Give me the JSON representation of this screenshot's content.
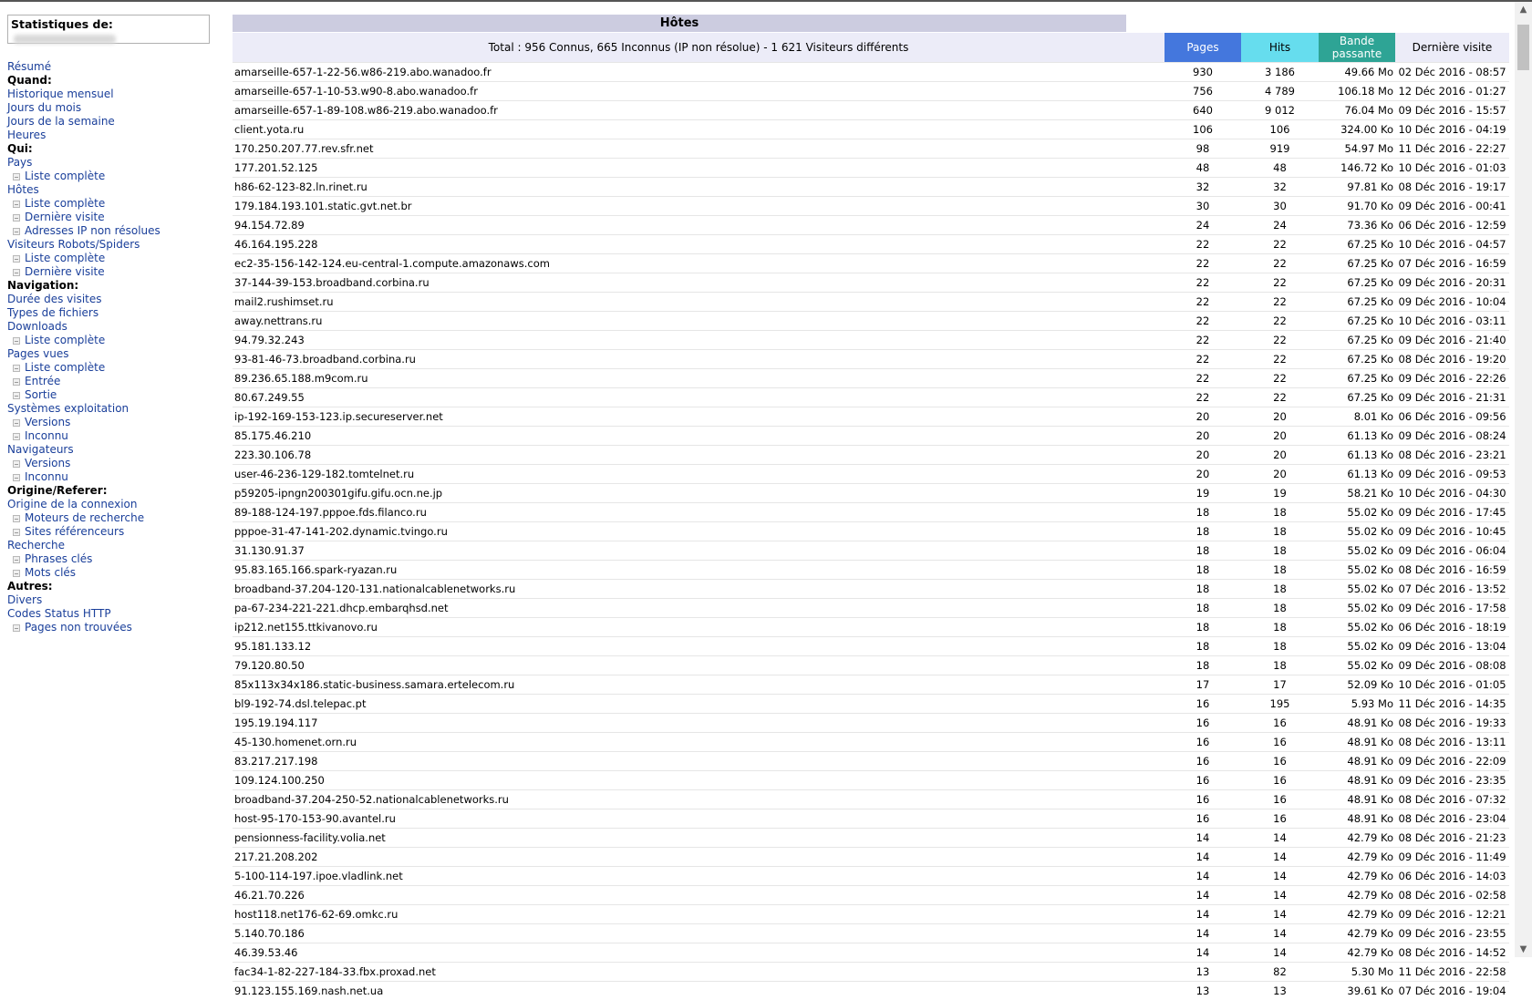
{
  "sidebar": {
    "title": "Statistiques de:",
    "menu": [
      {
        "t": "lnk",
        "label": "Résumé"
      },
      {
        "t": "sec",
        "label": "Quand:"
      },
      {
        "t": "lnk",
        "label": "Historique mensuel"
      },
      {
        "t": "lnk",
        "label": "Jours du mois"
      },
      {
        "t": "lnk",
        "label": "Jours de la semaine"
      },
      {
        "t": "lnk",
        "label": "Heures"
      },
      {
        "t": "sec",
        "label": "Qui:"
      },
      {
        "t": "lnk",
        "label": "Pays"
      },
      {
        "t": "sub",
        "label": "Liste complète"
      },
      {
        "t": "lnk",
        "label": "Hôtes"
      },
      {
        "t": "sub",
        "label": "Liste complète"
      },
      {
        "t": "sub",
        "label": "Dernière visite"
      },
      {
        "t": "sub",
        "label": "Adresses IP non résolues"
      },
      {
        "t": "lnk",
        "label": "Visiteurs Robots/Spiders"
      },
      {
        "t": "sub",
        "label": "Liste complète"
      },
      {
        "t": "sub",
        "label": "Dernière visite"
      },
      {
        "t": "sec",
        "label": "Navigation:"
      },
      {
        "t": "lnk",
        "label": "Durée des visites"
      },
      {
        "t": "lnk",
        "label": "Types de fichiers"
      },
      {
        "t": "lnk",
        "label": "Downloads"
      },
      {
        "t": "sub",
        "label": "Liste complète"
      },
      {
        "t": "lnk",
        "label": "Pages vues"
      },
      {
        "t": "sub",
        "label": "Liste complète"
      },
      {
        "t": "sub",
        "label": "Entrée"
      },
      {
        "t": "sub",
        "label": "Sortie"
      },
      {
        "t": "lnk",
        "label": "Systèmes exploitation"
      },
      {
        "t": "sub",
        "label": "Versions"
      },
      {
        "t": "sub",
        "label": "Inconnu"
      },
      {
        "t": "lnk",
        "label": "Navigateurs"
      },
      {
        "t": "sub",
        "label": "Versions"
      },
      {
        "t": "sub",
        "label": "Inconnu"
      },
      {
        "t": "sec",
        "label": "Origine/Referer:"
      },
      {
        "t": "lnk",
        "label": "Origine de la connexion"
      },
      {
        "t": "sub",
        "label": "Moteurs de recherche"
      },
      {
        "t": "sub",
        "label": "Sites référenceurs"
      },
      {
        "t": "lnk",
        "label": "Recherche"
      },
      {
        "t": "sub",
        "label": "Phrases clés"
      },
      {
        "t": "sub",
        "label": "Mots clés"
      },
      {
        "t": "sec",
        "label": "Autres:"
      },
      {
        "t": "lnk",
        "label": "Divers"
      },
      {
        "t": "lnk",
        "label": "Codes Status HTTP"
      },
      {
        "t": "sub",
        "label": "Pages non trouvées"
      }
    ]
  },
  "main": {
    "title": "Hôtes",
    "total": "Total : 956 Connus, 665 Inconnus (IP non résolue) - 1 621 Visiteurs différents",
    "headers": {
      "pages": "Pages",
      "hits": "Hits",
      "bw_line1": "Bande",
      "bw_line2": "passante",
      "last": "Dernière visite"
    },
    "colors": {
      "pages": "#4477dd",
      "hits": "#66ddee",
      "bandwidth": "#2ea495",
      "title_bg": "#cccce0"
    },
    "rows": [
      [
        "amarseille-657-1-22-56.w86-219.abo.wanadoo.fr",
        "930",
        "3 186",
        "49.66 Mo",
        "02 Déc 2016 - 08:57"
      ],
      [
        "amarseille-657-1-10-53.w90-8.abo.wanadoo.fr",
        "756",
        "4 789",
        "106.18 Mo",
        "12 Déc 2016 - 01:27"
      ],
      [
        "amarseille-657-1-89-108.w86-219.abo.wanadoo.fr",
        "640",
        "9 012",
        "76.04 Mo",
        "09 Déc 2016 - 15:57"
      ],
      [
        "client.yota.ru",
        "106",
        "106",
        "324.00 Ko",
        "10 Déc 2016 - 04:19"
      ],
      [
        "170.250.207.77.rev.sfr.net",
        "98",
        "919",
        "54.97 Mo",
        "11 Déc 2016 - 22:27"
      ],
      [
        "177.201.52.125",
        "48",
        "48",
        "146.72 Ko",
        "10 Déc 2016 - 01:03"
      ],
      [
        "h86-62-123-82.ln.rinet.ru",
        "32",
        "32",
        "97.81 Ko",
        "08 Déc 2016 - 19:17"
      ],
      [
        "179.184.193.101.static.gvt.net.br",
        "30",
        "30",
        "91.70 Ko",
        "09 Déc 2016 - 00:41"
      ],
      [
        "94.154.72.89",
        "24",
        "24",
        "73.36 Ko",
        "06 Déc 2016 - 12:59"
      ],
      [
        "46.164.195.228",
        "22",
        "22",
        "67.25 Ko",
        "10 Déc 2016 - 04:57"
      ],
      [
        "ec2-35-156-142-124.eu-central-1.compute.amazonaws.com",
        "22",
        "22",
        "67.25 Ko",
        "07 Déc 2016 - 16:59"
      ],
      [
        "37-144-39-153.broadband.corbina.ru",
        "22",
        "22",
        "67.25 Ko",
        "09 Déc 2016 - 20:31"
      ],
      [
        "mail2.rushimset.ru",
        "22",
        "22",
        "67.25 Ko",
        "09 Déc 2016 - 10:04"
      ],
      [
        "away.nettrans.ru",
        "22",
        "22",
        "67.25 Ko",
        "10 Déc 2016 - 03:11"
      ],
      [
        "94.79.32.243",
        "22",
        "22",
        "67.25 Ko",
        "09 Déc 2016 - 21:40"
      ],
      [
        "93-81-46-73.broadband.corbina.ru",
        "22",
        "22",
        "67.25 Ko",
        "08 Déc 2016 - 19:20"
      ],
      [
        "89.236.65.188.m9com.ru",
        "22",
        "22",
        "67.25 Ko",
        "09 Déc 2016 - 22:26"
      ],
      [
        "80.67.249.55",
        "22",
        "22",
        "67.25 Ko",
        "09 Déc 2016 - 21:31"
      ],
      [
        "ip-192-169-153-123.ip.secureserver.net",
        "20",
        "20",
        "8.01 Ko",
        "06 Déc 2016 - 09:56"
      ],
      [
        "85.175.46.210",
        "20",
        "20",
        "61.13 Ko",
        "09 Déc 2016 - 08:24"
      ],
      [
        "223.30.106.78",
        "20",
        "20",
        "61.13 Ko",
        "08 Déc 2016 - 23:21"
      ],
      [
        "user-46-236-129-182.tomtelnet.ru",
        "20",
        "20",
        "61.13 Ko",
        "09 Déc 2016 - 09:53"
      ],
      [
        "p59205-ipngn200301gifu.gifu.ocn.ne.jp",
        "19",
        "19",
        "58.21 Ko",
        "10 Déc 2016 - 04:30"
      ],
      [
        "89-188-124-197.pppoe.fds.filanco.ru",
        "18",
        "18",
        "55.02 Ko",
        "09 Déc 2016 - 17:45"
      ],
      [
        "pppoe-31-47-141-202.dynamic.tvingo.ru",
        "18",
        "18",
        "55.02 Ko",
        "09 Déc 2016 - 10:45"
      ],
      [
        "31.130.91.37",
        "18",
        "18",
        "55.02 Ko",
        "09 Déc 2016 - 06:04"
      ],
      [
        "95.83.165.166.spark-ryazan.ru",
        "18",
        "18",
        "55.02 Ko",
        "08 Déc 2016 - 16:59"
      ],
      [
        "broadband-37.204-120-131.nationalcablenetworks.ru",
        "18",
        "18",
        "55.02 Ko",
        "07 Déc 2016 - 13:52"
      ],
      [
        "pa-67-234-221-221.dhcp.embarqhsd.net",
        "18",
        "18",
        "55.02 Ko",
        "09 Déc 2016 - 17:58"
      ],
      [
        "ip212.net155.ttkivanovo.ru",
        "18",
        "18",
        "55.02 Ko",
        "06 Déc 2016 - 18:19"
      ],
      [
        "95.181.133.12",
        "18",
        "18",
        "55.02 Ko",
        "09 Déc 2016 - 13:04"
      ],
      [
        "79.120.80.50",
        "18",
        "18",
        "55.02 Ko",
        "09 Déc 2016 - 08:08"
      ],
      [
        "85x113x34x186.static-business.samara.ertelecom.ru",
        "17",
        "17",
        "52.09 Ko",
        "10 Déc 2016 - 01:05"
      ],
      [
        "bl9-192-74.dsl.telepac.pt",
        "16",
        "195",
        "5.93 Mo",
        "11 Déc 2016 - 14:35"
      ],
      [
        "195.19.194.117",
        "16",
        "16",
        "48.91 Ko",
        "08 Déc 2016 - 19:33"
      ],
      [
        "45-130.homenet.orn.ru",
        "16",
        "16",
        "48.91 Ko",
        "08 Déc 2016 - 13:11"
      ],
      [
        "83.217.217.198",
        "16",
        "16",
        "48.91 Ko",
        "09 Déc 2016 - 22:09"
      ],
      [
        "109.124.100.250",
        "16",
        "16",
        "48.91 Ko",
        "09 Déc 2016 - 23:35"
      ],
      [
        "broadband-37.204-250-52.nationalcablenetworks.ru",
        "16",
        "16",
        "48.91 Ko",
        "08 Déc 2016 - 07:32"
      ],
      [
        "host-95-170-153-90.avantel.ru",
        "16",
        "16",
        "48.91 Ko",
        "08 Déc 2016 - 23:04"
      ],
      [
        "pensionness-facility.volia.net",
        "14",
        "14",
        "42.79 Ko",
        "08 Déc 2016 - 21:23"
      ],
      [
        "217.21.208.202",
        "14",
        "14",
        "42.79 Ko",
        "09 Déc 2016 - 11:49"
      ],
      [
        "5-100-114-197.ipoe.vladlink.net",
        "14",
        "14",
        "42.79 Ko",
        "06 Déc 2016 - 14:03"
      ],
      [
        "46.21.70.226",
        "14",
        "14",
        "42.79 Ko",
        "08 Déc 2016 - 02:58"
      ],
      [
        "host118.net176-62-69.omkc.ru",
        "14",
        "14",
        "42.79 Ko",
        "09 Déc 2016 - 12:21"
      ],
      [
        "5.140.70.186",
        "14",
        "14",
        "42.79 Ko",
        "09 Déc 2016 - 23:55"
      ],
      [
        "46.39.53.46",
        "14",
        "14",
        "42.79 Ko",
        "08 Déc 2016 - 14:52"
      ],
      [
        "fac34-1-82-227-184-33.fbx.proxad.net",
        "13",
        "82",
        "5.30 Mo",
        "11 Déc 2016 - 22:58"
      ],
      [
        "91.123.155.169.nash.net.ua",
        "13",
        "13",
        "39.61 Ko",
        "07 Déc 2016 - 19:04"
      ]
    ]
  },
  "scrollbar": {
    "up": "▲",
    "down": "▼"
  }
}
